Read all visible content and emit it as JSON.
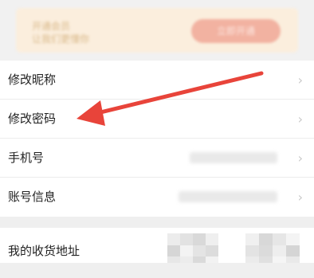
{
  "banner": {
    "line1": "开通会员",
    "line2": "让我们更懂你",
    "button_label": "立即开通"
  },
  "settings": {
    "items": [
      {
        "label": "修改昵称"
      },
      {
        "label": "修改密码"
      },
      {
        "label": "手机号"
      },
      {
        "label": "账号信息"
      }
    ],
    "address": {
      "label": "我的收货地址"
    }
  },
  "icons": {
    "chevron": "chevron-right-icon",
    "annotation": "red-arrow-annotation"
  },
  "colors": {
    "arrow": "#e8443a",
    "banner_bg": "#fbeedd",
    "banner_button": "#f2b2a1"
  }
}
